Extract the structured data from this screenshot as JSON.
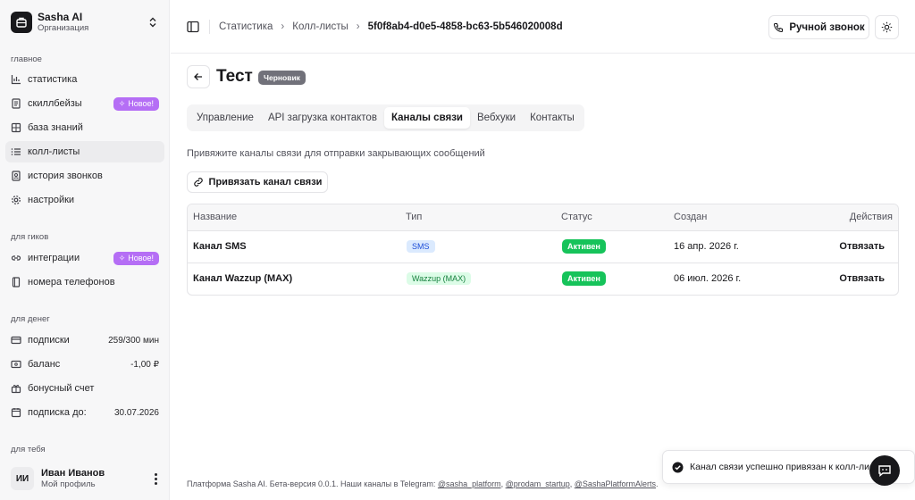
{
  "org": {
    "name": "Sasha AI",
    "subtitle": "Организация"
  },
  "sidebar": {
    "groups": [
      {
        "label": "главное"
      },
      {
        "label": "для гиков"
      },
      {
        "label": "для денег"
      },
      {
        "label": "для тебя"
      }
    ],
    "main_items": [
      {
        "label": "статистика",
        "icon": "bar-chart-icon"
      },
      {
        "label": "скиллбейзы",
        "icon": "document-icon",
        "badge": "Новое!"
      },
      {
        "label": "база знаний",
        "icon": "grid-icon"
      },
      {
        "label": "колл-листы",
        "icon": "list-icon",
        "active": true
      },
      {
        "label": "история звонков",
        "icon": "contact-book-icon"
      },
      {
        "label": "настройки",
        "icon": "gear-icon"
      }
    ],
    "geek_items": [
      {
        "label": "интеграции",
        "icon": "link-icon",
        "badge": "Новое!"
      },
      {
        "label": "номера телефонов",
        "icon": "phone-book-icon"
      }
    ],
    "money_items": [
      {
        "label": "подписки",
        "icon": "card-icon",
        "value": "259/300 мин"
      },
      {
        "label": "баланс",
        "icon": "wallet-icon",
        "value": "-1,00 ₽"
      },
      {
        "label": "бонусный счет",
        "icon": "gift-icon"
      },
      {
        "label": "подписка до:",
        "icon": "calendar-icon",
        "value": "30.07.2026"
      }
    ]
  },
  "user": {
    "initials": "ИИ",
    "name": "Иван Иванов",
    "subtitle": "Мой профиль"
  },
  "breadcrumb": [
    "Статистика",
    "Колл-листы",
    "5f0f8ab4-d0e5-4858-bc63-5b546020008d"
  ],
  "topbar": {
    "call_button": "Ручной звонок"
  },
  "page": {
    "title": "Тест",
    "status": "Черновик"
  },
  "tabs": [
    {
      "label": "Управление"
    },
    {
      "label": "API загрузка контактов"
    },
    {
      "label": "Каналы связи",
      "active": true
    },
    {
      "label": "Вебхуки"
    },
    {
      "label": "Контакты"
    }
  ],
  "channels": {
    "description": "Привяжите каналы связи для отправки закрывающих сообщений",
    "link_button": "Привязать канал связи",
    "columns": [
      "Название",
      "Тип",
      "Статус",
      "Создан",
      "Действия"
    ],
    "rows": [
      {
        "name": "Канал SMS",
        "type": "SMS",
        "status": "Активен",
        "created": "16 апр. 2026 г.",
        "action": "Отвязать"
      },
      {
        "name": "Канал Wazzup (MAX)",
        "type": "Wazzup (MAX)",
        "status": "Активен",
        "created": "06 июл. 2026 г.",
        "action": "Отвязать"
      }
    ]
  },
  "footer": {
    "text": "Платформа Sasha AI. Бета-версия 0.0.1. Наши каналы в Telegram: ",
    "links": [
      "@sasha_platform",
      "@prodam_startup",
      "@SashaPlatformAlerts"
    ]
  },
  "toast": {
    "text": "Канал связи успешно привязан к колл-листу"
  },
  "colors": {
    "accent_purple": "#b56ef5",
    "active_green": "#16c35a",
    "sms_blue": "#1d4ed8",
    "wazzup_green": "#15803d"
  }
}
